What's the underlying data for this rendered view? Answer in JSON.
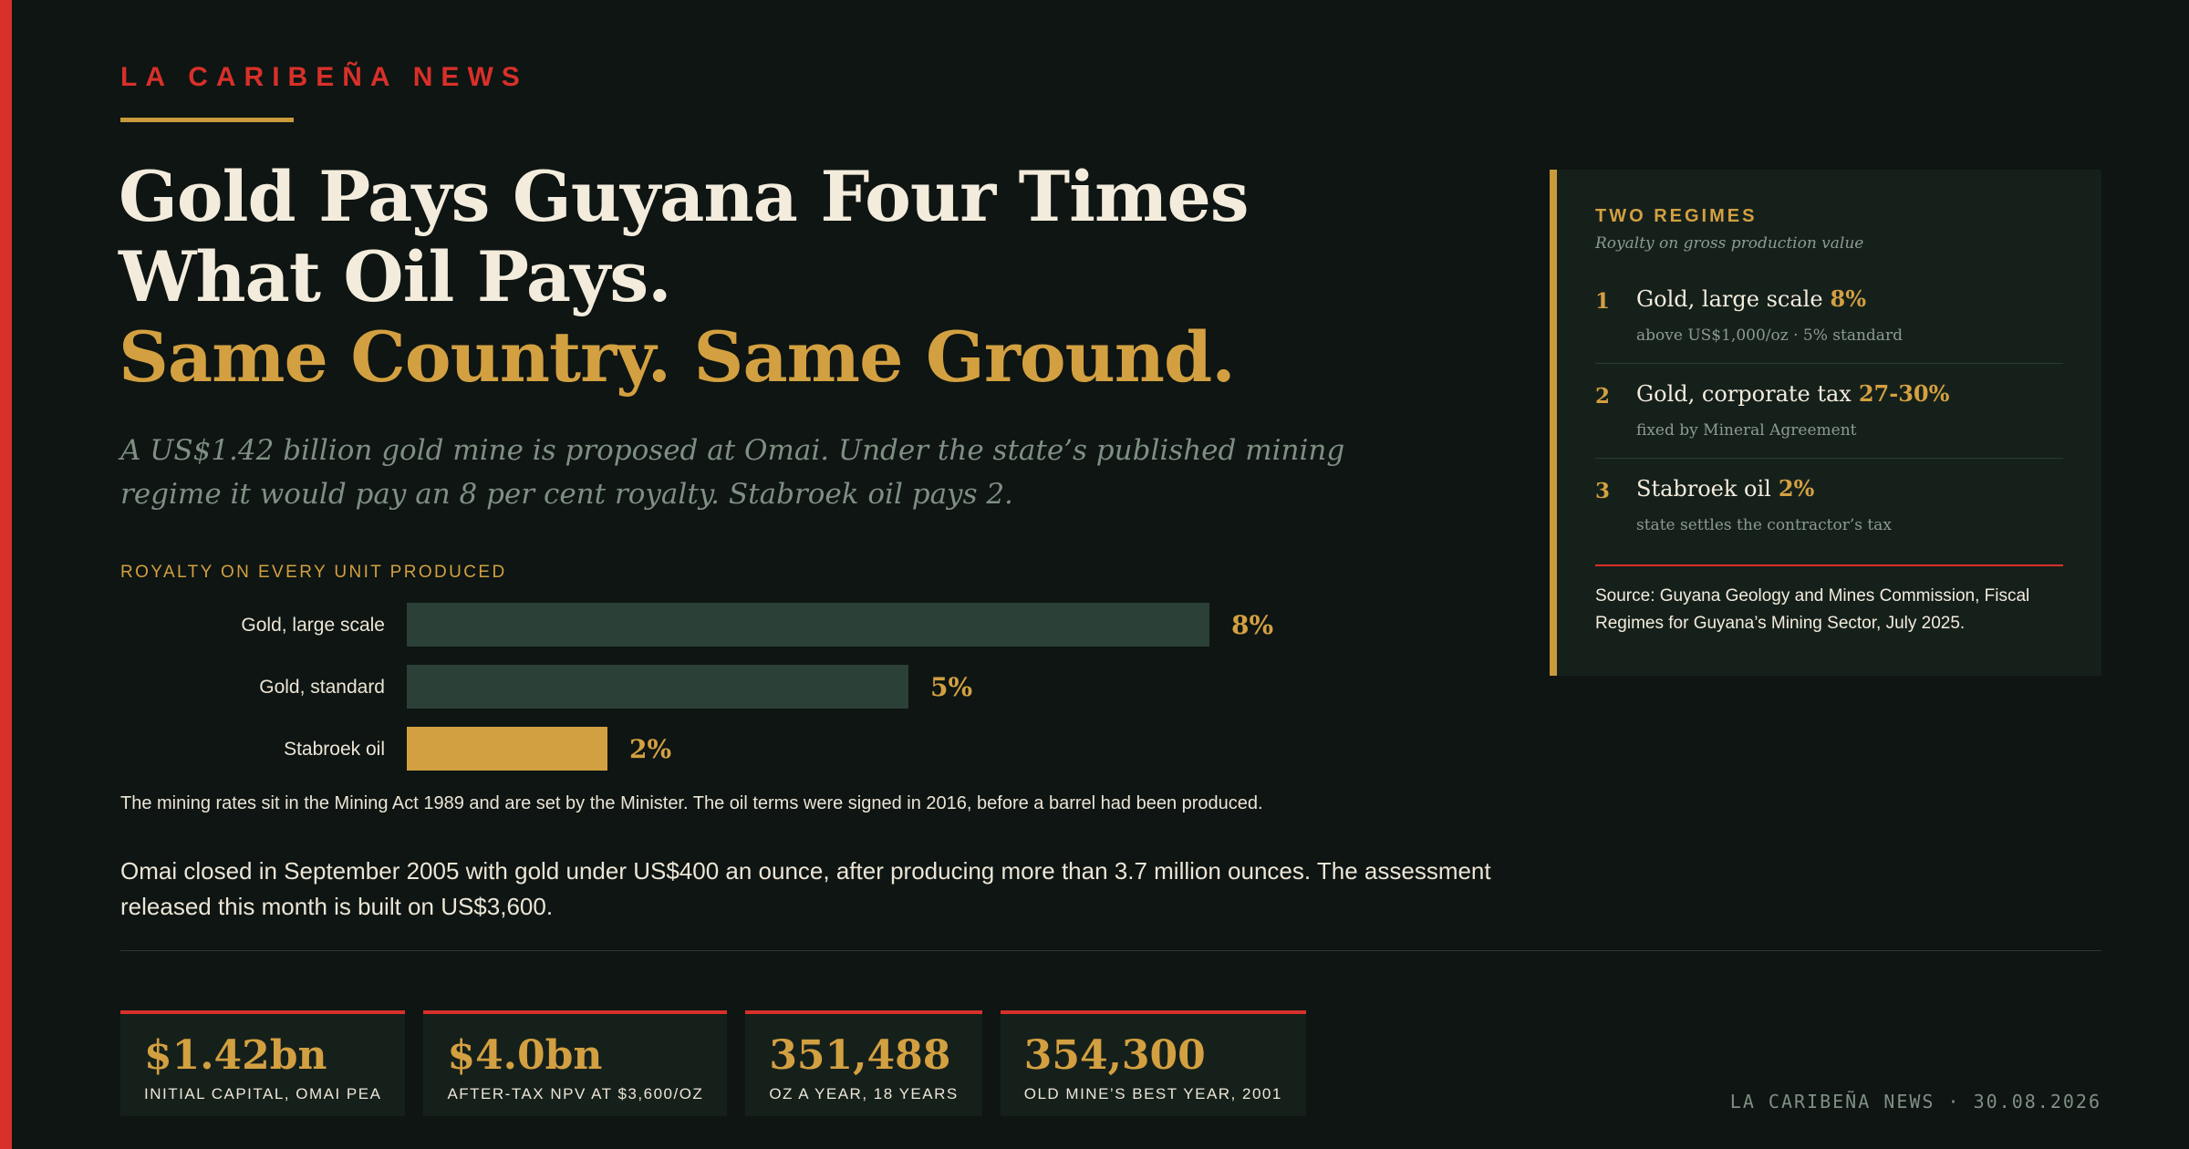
{
  "masthead": {
    "brand": "LA CARIBEÑA NEWS"
  },
  "headline": {
    "line1": "Gold Pays Guyana Four Times",
    "line2": "What Oil Pays.",
    "line3": "Same Country. Same Ground."
  },
  "standfirst": "A US$1.42 billion gold mine is proposed at Omai. Under the state’s published mining regime it would pay an 8 per cent royalty. Stabroek oil pays 2.",
  "chart_section": {
    "label": "ROYALTY ON EVERY UNIT PRODUCED",
    "note": "The mining rates sit in the Mining Act 1989 and are set by the Minister. The oil terms were signed in 2016, before a barrel had been produced."
  },
  "chart_data": {
    "type": "bar",
    "orientation": "horizontal",
    "title": "ROYALTY ON EVERY UNIT PRODUCED",
    "categories": [
      "Gold, large scale",
      "Gold, standard",
      "Stabroek oil"
    ],
    "values": [
      8,
      5,
      2
    ],
    "value_labels": [
      "8%",
      "5%",
      "2%"
    ],
    "unit": "%",
    "xlim": [
      0,
      8
    ],
    "grid": false,
    "colors": [
      "#2b4036",
      "#2b4036",
      "#d3a041"
    ]
  },
  "body_text": "Omai closed in September 2005 with gold under US$400 an ounce, after producing more than 3.7 million ounces. The assessment released this month is built on US$3,600.",
  "sidebar": {
    "title": "TWO REGIMES",
    "subtitle": "Royalty on gross production value",
    "items": [
      {
        "num": "1",
        "name": "Gold, large scale",
        "rate": "8%",
        "detail": "above US$1,000/oz · 5% standard"
      },
      {
        "num": "2",
        "name": "Gold, corporate tax",
        "rate": "27-30%",
        "detail": "fixed by Mineral Agreement"
      },
      {
        "num": "3",
        "name": "Stabroek oil",
        "rate": "2%",
        "detail": "state settles the contractor’s tax"
      }
    ],
    "source": "Source: Guyana Geology and Mines Commission, Fiscal Regimes for Guyana’s Mining Sector, July 2025."
  },
  "stats": [
    {
      "value": "$1.42bn",
      "label": "INITIAL CAPITAL, OMAI PEA"
    },
    {
      "value": "$4.0bn",
      "label": "AFTER-TAX NPV AT $3,600/OZ"
    },
    {
      "value": "351,488",
      "label": "OZ A YEAR, 18 YEARS"
    },
    {
      "value": "354,300",
      "label": "OLD MINE’S BEST YEAR, 2001"
    }
  ],
  "footer": "LA CARIBEÑA NEWS · 30.08.2026",
  "colors": {
    "accent_red": "#d8302a",
    "gold": "#d3a041",
    "background": "#0e1512",
    "panel": "#16201b",
    "bar_dark": "#2b4036"
  }
}
